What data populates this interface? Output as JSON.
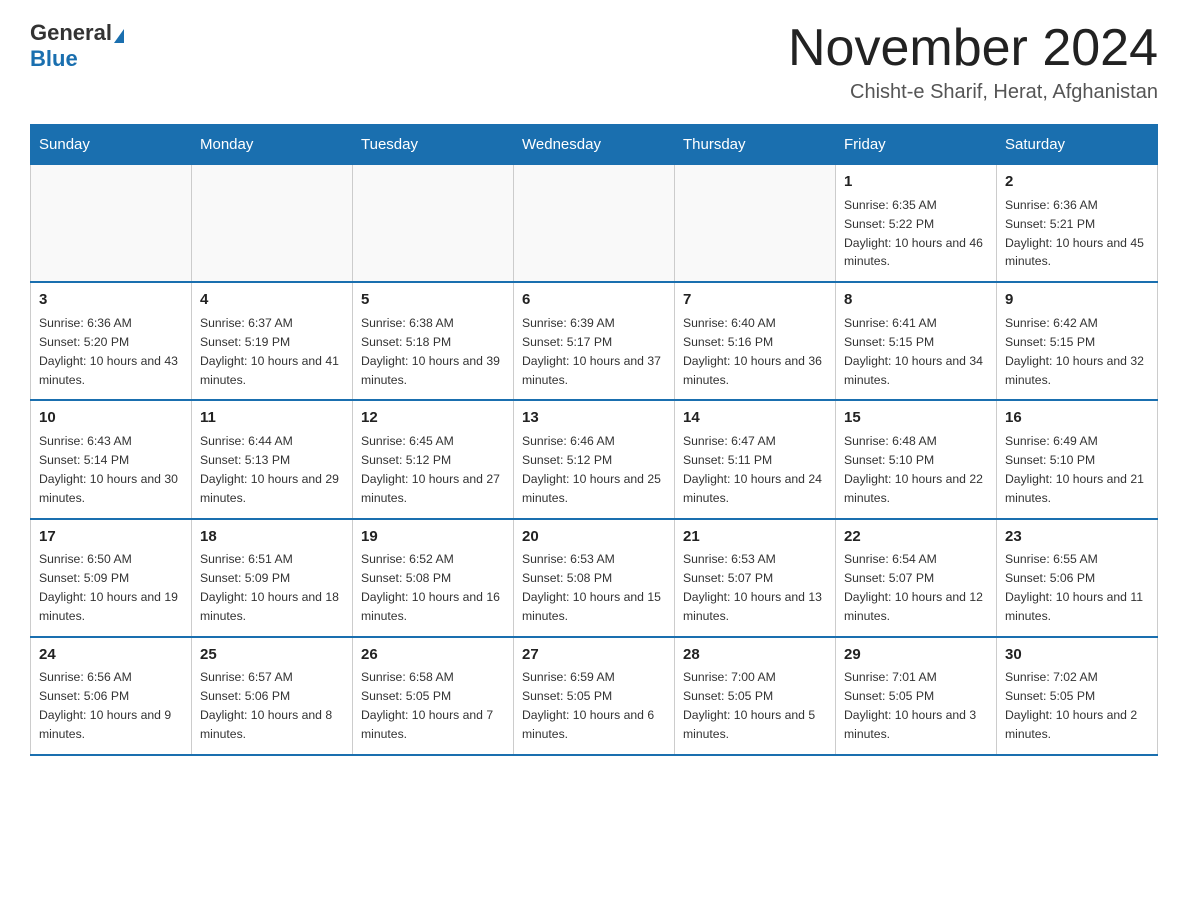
{
  "header": {
    "logo_general": "General",
    "logo_blue": "Blue",
    "month_title": "November 2024",
    "location": "Chisht-e Sharif, Herat, Afghanistan"
  },
  "days_of_week": [
    "Sunday",
    "Monday",
    "Tuesday",
    "Wednesday",
    "Thursday",
    "Friday",
    "Saturday"
  ],
  "weeks": [
    [
      {
        "day": "",
        "info": ""
      },
      {
        "day": "",
        "info": ""
      },
      {
        "day": "",
        "info": ""
      },
      {
        "day": "",
        "info": ""
      },
      {
        "day": "",
        "info": ""
      },
      {
        "day": "1",
        "info": "Sunrise: 6:35 AM\nSunset: 5:22 PM\nDaylight: 10 hours and 46 minutes."
      },
      {
        "day": "2",
        "info": "Sunrise: 6:36 AM\nSunset: 5:21 PM\nDaylight: 10 hours and 45 minutes."
      }
    ],
    [
      {
        "day": "3",
        "info": "Sunrise: 6:36 AM\nSunset: 5:20 PM\nDaylight: 10 hours and 43 minutes."
      },
      {
        "day": "4",
        "info": "Sunrise: 6:37 AM\nSunset: 5:19 PM\nDaylight: 10 hours and 41 minutes."
      },
      {
        "day": "5",
        "info": "Sunrise: 6:38 AM\nSunset: 5:18 PM\nDaylight: 10 hours and 39 minutes."
      },
      {
        "day": "6",
        "info": "Sunrise: 6:39 AM\nSunset: 5:17 PM\nDaylight: 10 hours and 37 minutes."
      },
      {
        "day": "7",
        "info": "Sunrise: 6:40 AM\nSunset: 5:16 PM\nDaylight: 10 hours and 36 minutes."
      },
      {
        "day": "8",
        "info": "Sunrise: 6:41 AM\nSunset: 5:15 PM\nDaylight: 10 hours and 34 minutes."
      },
      {
        "day": "9",
        "info": "Sunrise: 6:42 AM\nSunset: 5:15 PM\nDaylight: 10 hours and 32 minutes."
      }
    ],
    [
      {
        "day": "10",
        "info": "Sunrise: 6:43 AM\nSunset: 5:14 PM\nDaylight: 10 hours and 30 minutes."
      },
      {
        "day": "11",
        "info": "Sunrise: 6:44 AM\nSunset: 5:13 PM\nDaylight: 10 hours and 29 minutes."
      },
      {
        "day": "12",
        "info": "Sunrise: 6:45 AM\nSunset: 5:12 PM\nDaylight: 10 hours and 27 minutes."
      },
      {
        "day": "13",
        "info": "Sunrise: 6:46 AM\nSunset: 5:12 PM\nDaylight: 10 hours and 25 minutes."
      },
      {
        "day": "14",
        "info": "Sunrise: 6:47 AM\nSunset: 5:11 PM\nDaylight: 10 hours and 24 minutes."
      },
      {
        "day": "15",
        "info": "Sunrise: 6:48 AM\nSunset: 5:10 PM\nDaylight: 10 hours and 22 minutes."
      },
      {
        "day": "16",
        "info": "Sunrise: 6:49 AM\nSunset: 5:10 PM\nDaylight: 10 hours and 21 minutes."
      }
    ],
    [
      {
        "day": "17",
        "info": "Sunrise: 6:50 AM\nSunset: 5:09 PM\nDaylight: 10 hours and 19 minutes."
      },
      {
        "day": "18",
        "info": "Sunrise: 6:51 AM\nSunset: 5:09 PM\nDaylight: 10 hours and 18 minutes."
      },
      {
        "day": "19",
        "info": "Sunrise: 6:52 AM\nSunset: 5:08 PM\nDaylight: 10 hours and 16 minutes."
      },
      {
        "day": "20",
        "info": "Sunrise: 6:53 AM\nSunset: 5:08 PM\nDaylight: 10 hours and 15 minutes."
      },
      {
        "day": "21",
        "info": "Sunrise: 6:53 AM\nSunset: 5:07 PM\nDaylight: 10 hours and 13 minutes."
      },
      {
        "day": "22",
        "info": "Sunrise: 6:54 AM\nSunset: 5:07 PM\nDaylight: 10 hours and 12 minutes."
      },
      {
        "day": "23",
        "info": "Sunrise: 6:55 AM\nSunset: 5:06 PM\nDaylight: 10 hours and 11 minutes."
      }
    ],
    [
      {
        "day": "24",
        "info": "Sunrise: 6:56 AM\nSunset: 5:06 PM\nDaylight: 10 hours and 9 minutes."
      },
      {
        "day": "25",
        "info": "Sunrise: 6:57 AM\nSunset: 5:06 PM\nDaylight: 10 hours and 8 minutes."
      },
      {
        "day": "26",
        "info": "Sunrise: 6:58 AM\nSunset: 5:05 PM\nDaylight: 10 hours and 7 minutes."
      },
      {
        "day": "27",
        "info": "Sunrise: 6:59 AM\nSunset: 5:05 PM\nDaylight: 10 hours and 6 minutes."
      },
      {
        "day": "28",
        "info": "Sunrise: 7:00 AM\nSunset: 5:05 PM\nDaylight: 10 hours and 5 minutes."
      },
      {
        "day": "29",
        "info": "Sunrise: 7:01 AM\nSunset: 5:05 PM\nDaylight: 10 hours and 3 minutes."
      },
      {
        "day": "30",
        "info": "Sunrise: 7:02 AM\nSunset: 5:05 PM\nDaylight: 10 hours and 2 minutes."
      }
    ]
  ]
}
